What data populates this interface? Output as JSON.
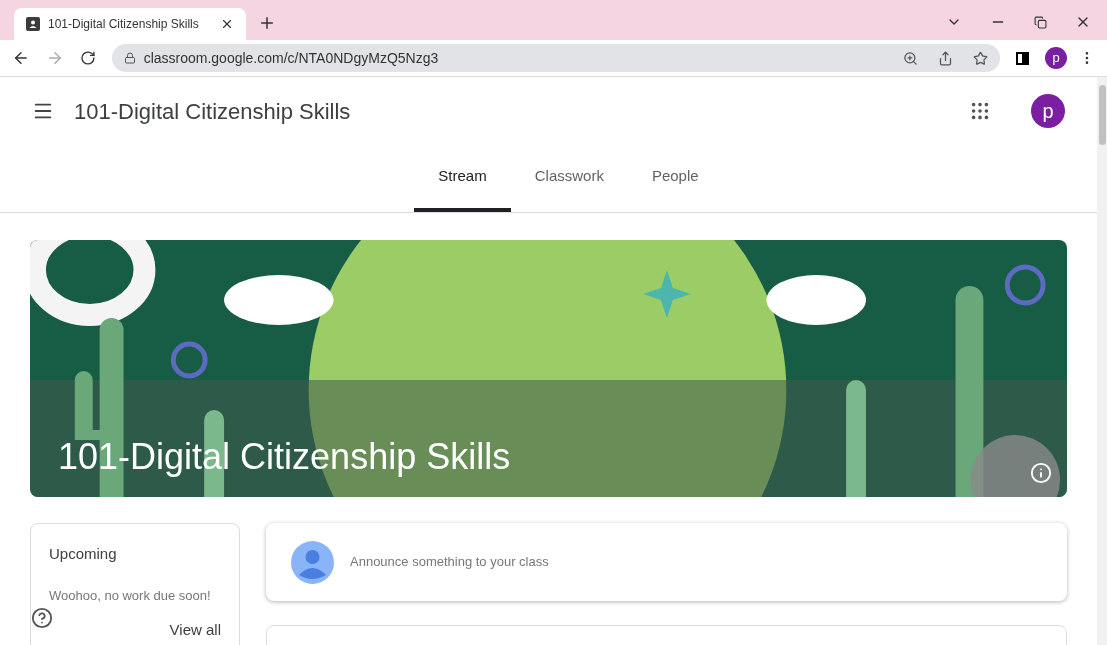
{
  "browser": {
    "tab_title": "101-Digital Citizenship Skills",
    "url": "classroom.google.com/c/NTA0NDgyMzQ5Nzg3",
    "profile_initial": "p"
  },
  "header": {
    "title": "101-Digital Citizenship Skills",
    "avatar_initial": "p"
  },
  "tabs": [
    {
      "label": "Stream",
      "selected": true
    },
    {
      "label": "Classwork",
      "selected": false
    },
    {
      "label": "People",
      "selected": false
    }
  ],
  "banner": {
    "kind": "picture",
    "title": "101-Digital Citizenship Skills"
  },
  "upcoming": {
    "title": "Upcoming",
    "message": "Woohoo, no work due soon!",
    "link": "View all"
  },
  "announce": {
    "placeholder": "Announce something to your class"
  }
}
